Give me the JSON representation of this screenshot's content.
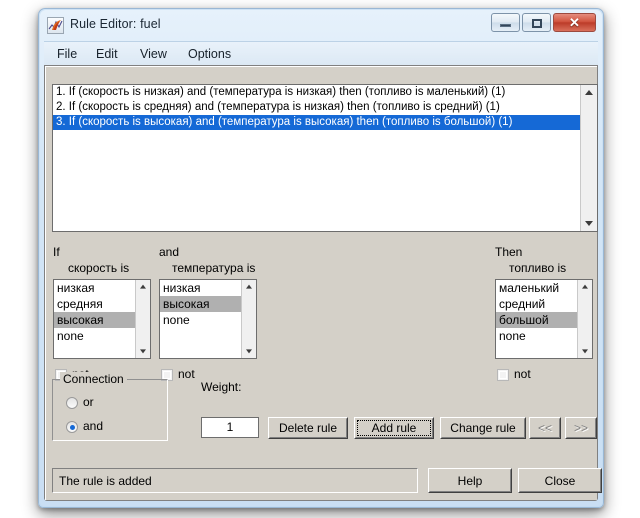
{
  "window": {
    "title": "Rule Editor: fuel",
    "icon": "matlab-membrane-icon",
    "minimize_label": "",
    "maximize_label": "",
    "close_label": "✕"
  },
  "menu": [
    {
      "label": "File"
    },
    {
      "label": "Edit"
    },
    {
      "label": "View"
    },
    {
      "label": "Options"
    }
  ],
  "rules": [
    {
      "text": "1. If (скорость is низкая) and (температура is низкая) then (топливо is маленький) (1)",
      "selected": false
    },
    {
      "text": "2. If (скорость is средняя) and (температура is низкая) then (топливо is средний) (1)",
      "selected": false
    },
    {
      "text": "3. If (скорость is высокая) and (температура is высокая) then (топливо is большой) (1)",
      "selected": true
    }
  ],
  "antecedent1": {
    "connective": "If",
    "variable": "скорость is",
    "items": [
      {
        "label": "низкая",
        "selected": false
      },
      {
        "label": "средняя",
        "selected": false
      },
      {
        "label": "высокая",
        "selected": true
      },
      {
        "label": "none",
        "selected": false
      }
    ],
    "not_label": "not",
    "not_checked": false
  },
  "antecedent2": {
    "connective": "and",
    "variable": "температура is",
    "items": [
      {
        "label": "низкая",
        "selected": false
      },
      {
        "label": "высокая",
        "selected": true
      },
      {
        "label": "none",
        "selected": false
      }
    ],
    "not_label": "not",
    "not_checked": false
  },
  "consequent": {
    "connective": "Then",
    "variable": "топливо is",
    "items": [
      {
        "label": "маленький",
        "selected": false
      },
      {
        "label": "средний",
        "selected": false
      },
      {
        "label": "большой",
        "selected": true
      },
      {
        "label": "none",
        "selected": false
      }
    ],
    "not_label": "not",
    "not_checked": false
  },
  "connection": {
    "legend": "Connection",
    "options": [
      {
        "label": "or",
        "selected": false
      },
      {
        "label": "and",
        "selected": true
      }
    ]
  },
  "weight": {
    "label": "Weight:",
    "value": "1"
  },
  "actions": {
    "delete_rule": "Delete rule",
    "add_rule": "Add rule",
    "change_rule": "Change rule",
    "prev": "<<",
    "next": ">>"
  },
  "status": {
    "message": "The rule is added"
  },
  "footer": {
    "help": "Help",
    "close": "Close"
  },
  "colors": {
    "selection_blue": "#1569d6",
    "listbox_selection_grey": "#b0b0b0",
    "panel_grey": "#d4d0c8",
    "titlebar_glass": "#cfe3f5",
    "close_red": "#c7412c"
  }
}
